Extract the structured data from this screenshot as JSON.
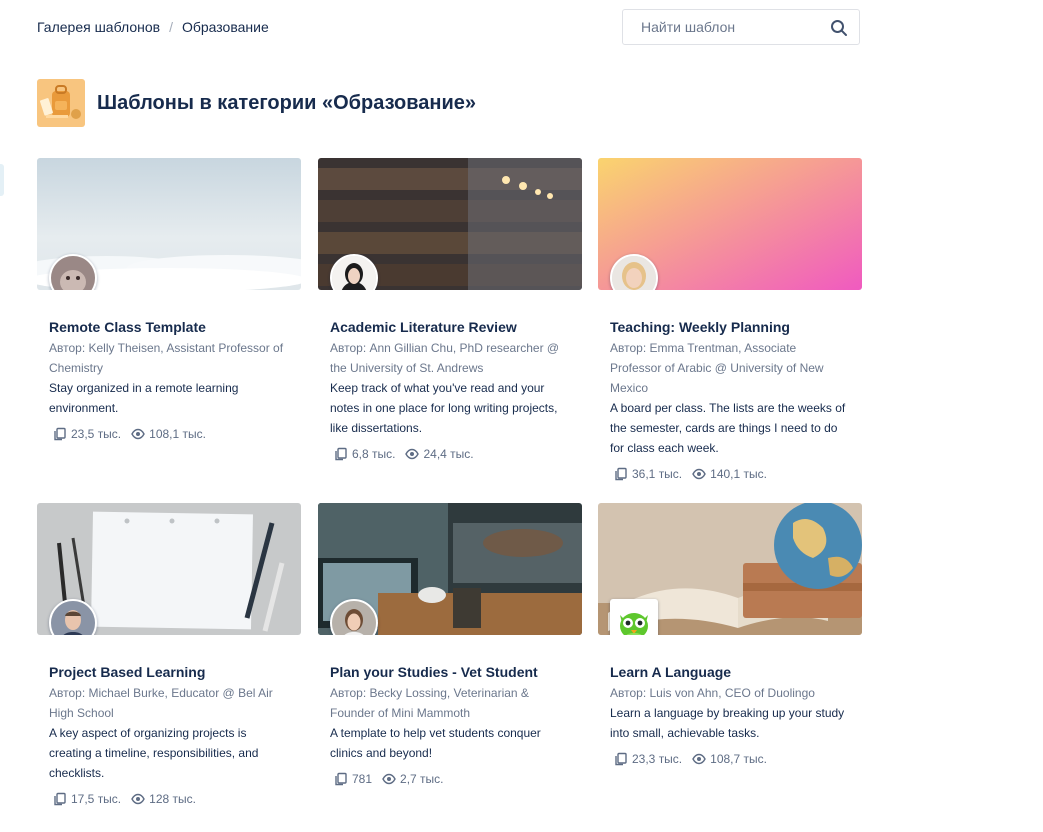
{
  "breadcrumb": {
    "gallery": "Галерея шаблонов",
    "separator": "/",
    "category": "Образование"
  },
  "search": {
    "placeholder": "Найти шаблон"
  },
  "category": {
    "title": "Шаблоны в категории «Образование»",
    "icon": "backpack-icon",
    "accent": "#f8c57f"
  },
  "cards": [
    {
      "title": "Remote Class Template",
      "author": "Автор: Kelly Theisen, Assistant Professor of Chemistry",
      "description": "Stay organized in a remote learning environment.",
      "copies": "23,5 тыс.",
      "views": "108,1 тыс."
    },
    {
      "title": "Academic Literature Review",
      "author": "Автор: Ann Gillian Chu, PhD researcher @ the University of St. Andrews",
      "description": "Keep track of what you've read and your notes in one place for long writing projects, like dissertations.",
      "copies": "6,8 тыс.",
      "views": "24,4 тыс."
    },
    {
      "title": "Teaching: Weekly Planning",
      "author": "Автор: Emma Trentman, Associate Professor of Arabic @ University of New Mexico",
      "description": "A board per class. The lists are the weeks of the semester, cards are things I need to do for class each week.",
      "copies": "36,1 тыс.",
      "views": "140,1 тыс."
    },
    {
      "title": "Project Based Learning",
      "author": "Автор: Michael Burke, Educator @ Bel Air High School",
      "description": "A key aspect of organizing projects is creating a timeline, responsibilities, and checklists.",
      "copies": "17,5 тыс.",
      "views": "128 тыс."
    },
    {
      "title": "Plan your Studies - Vet Student",
      "author": "Автор: Becky Lossing, Veterinarian & Founder of Mini Mammoth",
      "description": "A template to help vet students conquer clinics and beyond!",
      "copies": "781",
      "views": "2,7 тыс."
    },
    {
      "title": "Learn A Language",
      "author": "Автор: Luis von Ahn, CEO of Duolingo",
      "description": "Learn a language by breaking up your study into small, achievable tasks.",
      "copies": "23,3 тыс.",
      "views": "108,7 тыс."
    }
  ],
  "icons": {
    "copies": "copy-icon",
    "views": "eye-icon",
    "search": "search-icon"
  }
}
